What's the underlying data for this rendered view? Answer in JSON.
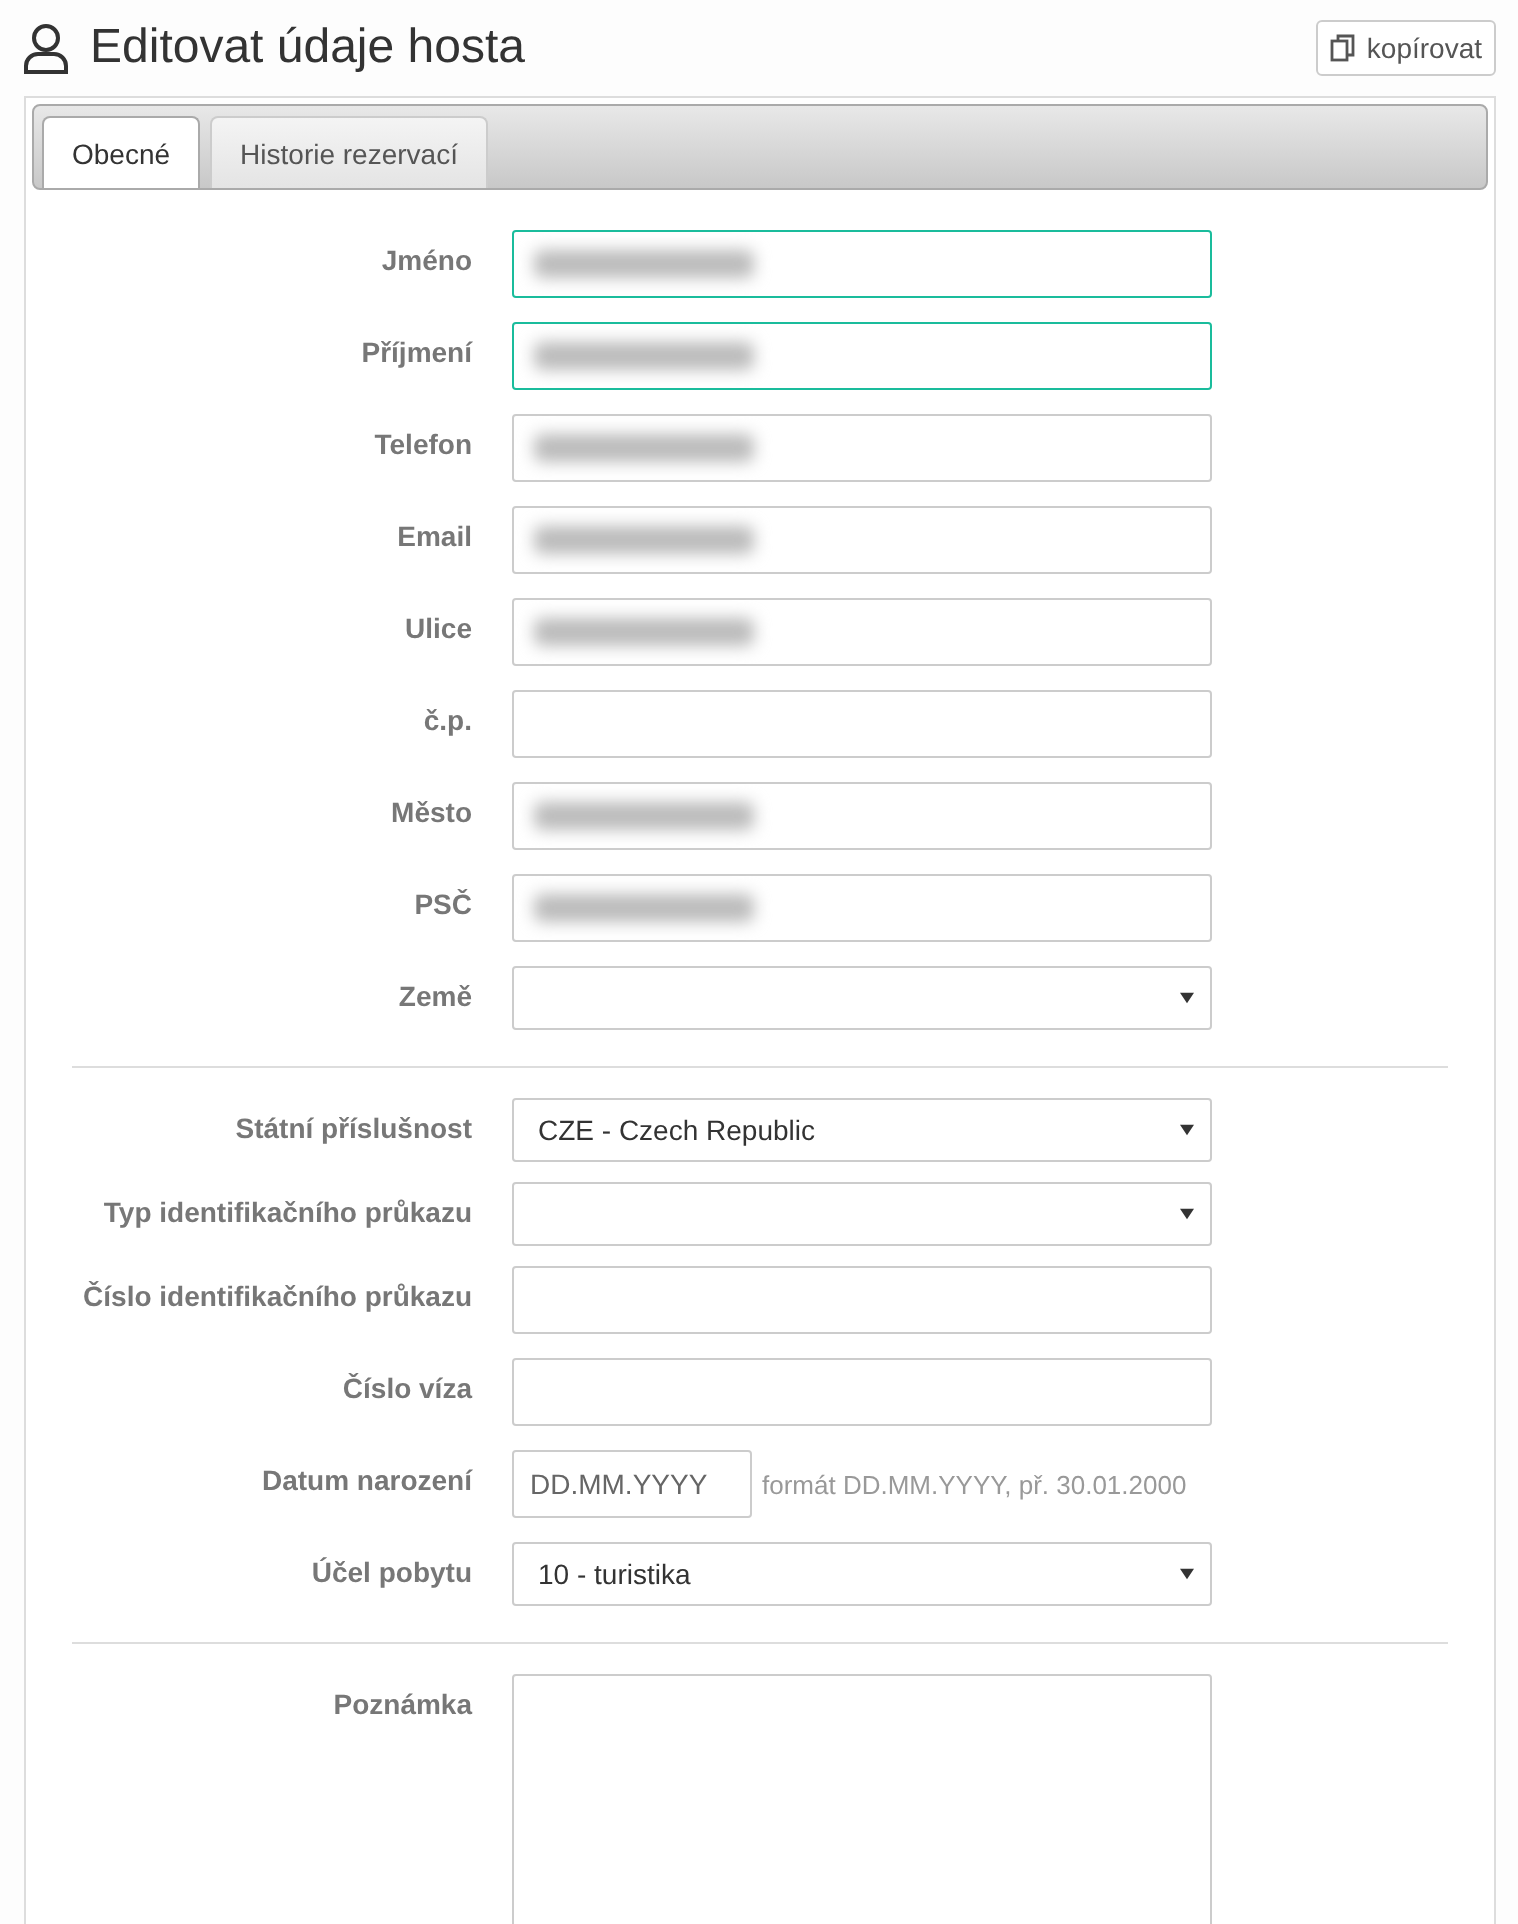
{
  "header": {
    "title": "Editovat údaje hosta",
    "copy_button": "kopírovat"
  },
  "tabs": [
    {
      "label": "Obecné",
      "selected": true
    },
    {
      "label": "Historie rezervací",
      "selected": false
    }
  ],
  "sections": [
    {
      "fields": [
        {
          "kind": "text",
          "label": "Jméno",
          "highlighted": true,
          "redacted": true
        },
        {
          "kind": "text",
          "label": "Příjmení",
          "highlighted": true,
          "redacted": true
        },
        {
          "kind": "text",
          "label": "Telefon",
          "highlighted": false,
          "redacted": true
        },
        {
          "kind": "text",
          "label": "Email",
          "highlighted": false,
          "redacted": true
        },
        {
          "kind": "text",
          "label": "Ulice",
          "highlighted": false,
          "redacted": true
        },
        {
          "kind": "text",
          "label": "č.p.",
          "highlighted": false,
          "redacted": false
        },
        {
          "kind": "text",
          "label": "Město",
          "highlighted": false,
          "redacted": true
        },
        {
          "kind": "text",
          "label": "PSČ",
          "highlighted": false,
          "redacted": true
        },
        {
          "kind": "select",
          "label": "Země"
        }
      ]
    },
    {
      "fields": [
        {
          "kind": "select",
          "label": "Státní příslušnost",
          "value": "CZE - Czech Republic"
        },
        {
          "kind": "select",
          "label": "Typ identifikačního průkazu"
        },
        {
          "kind": "text",
          "label": "Číslo identifikačního průkazu",
          "highlighted": false,
          "redacted": false
        },
        {
          "kind": "text",
          "label": "Číslo víza",
          "highlighted": false,
          "redacted": false
        },
        {
          "kind": "date",
          "label": "Datum narození",
          "placeholder": "DD.MM.YYYY",
          "hint": "formát DD.MM.YYYY, př. 30.01.2000"
        },
        {
          "kind": "select",
          "label": "Účel pobytu",
          "value": "10 - turistika"
        }
      ]
    },
    {
      "fields": [
        {
          "kind": "textarea",
          "label": "Poznámka"
        }
      ]
    }
  ]
}
